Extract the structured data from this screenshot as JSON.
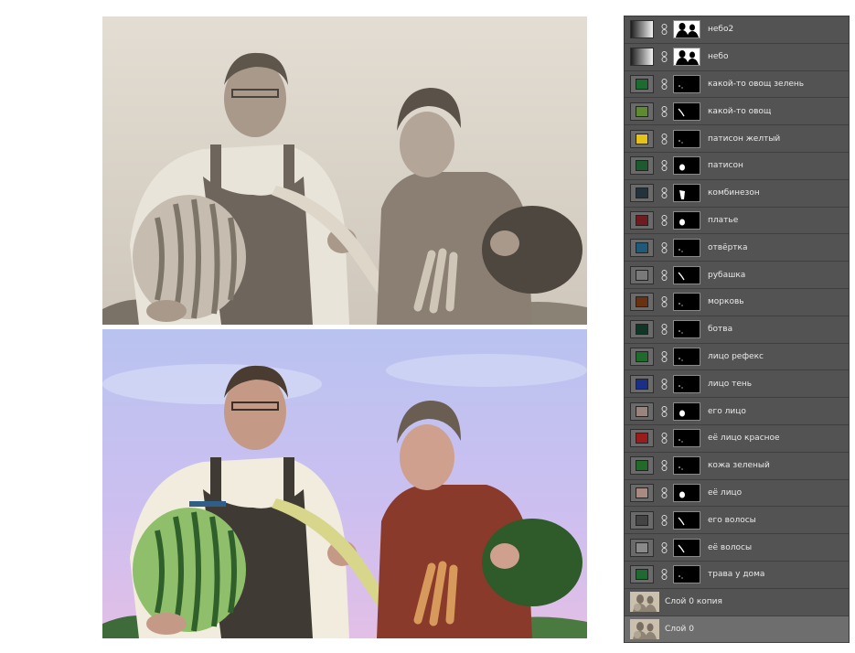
{
  "layers": [
    {
      "name": "небо2",
      "fill_type": "gradient",
      "mask": "silhouette"
    },
    {
      "name": "небо",
      "fill_type": "gradient",
      "mask": "silhouette"
    },
    {
      "name": "какой-то овощ зелень",
      "color": "#1e6b32",
      "mask": "dots"
    },
    {
      "name": "какой-то овощ",
      "color": "#5f8a30",
      "mask": "stroke"
    },
    {
      "name": "патисон желтый",
      "color": "#e3c21a",
      "mask": "dots"
    },
    {
      "name": "патисон",
      "color": "#1c5a30",
      "mask": "blob"
    },
    {
      "name": "комбинезон",
      "color": "#22333e",
      "mask": "figure"
    },
    {
      "name": "платье",
      "color": "#6e1c22",
      "mask": "blob"
    },
    {
      "name": "отвёртка",
      "color": "#1f5a78",
      "mask": "dots"
    },
    {
      "name": "рубашка",
      "color": "#7a7a7a",
      "mask": "stroke"
    },
    {
      "name": "морковь",
      "color": "#6a3210",
      "mask": "dots"
    },
    {
      "name": "ботва",
      "color": "#103628",
      "mask": "dots"
    },
    {
      "name": "лицо рефекс",
      "color": "#1f6b2c",
      "mask": "dots"
    },
    {
      "name": "лицо тень",
      "color": "#1a2f8a",
      "mask": "dots"
    },
    {
      "name": "его лицо",
      "color": "#9a857e",
      "mask": "blob"
    },
    {
      "name": "её лицо красное",
      "color": "#9a1c1c",
      "mask": "dots"
    },
    {
      "name": "кожа зеленый",
      "color": "#226a2a",
      "mask": "dots"
    },
    {
      "name": "её лицо",
      "color": "#a88a82",
      "mask": "blob"
    },
    {
      "name": "его волосы",
      "color": "#444444",
      "mask": "stroke"
    },
    {
      "name": "её волосы",
      "color": "#8a8a8a",
      "mask": "stroke"
    },
    {
      "name": "трава у дома",
      "color": "#1e6a30",
      "mask": "dots"
    },
    {
      "name": "Слой 0 копия",
      "fill_type": "photo",
      "selected": false
    },
    {
      "name": "Слой 0",
      "fill_type": "photo",
      "selected": true
    }
  ]
}
